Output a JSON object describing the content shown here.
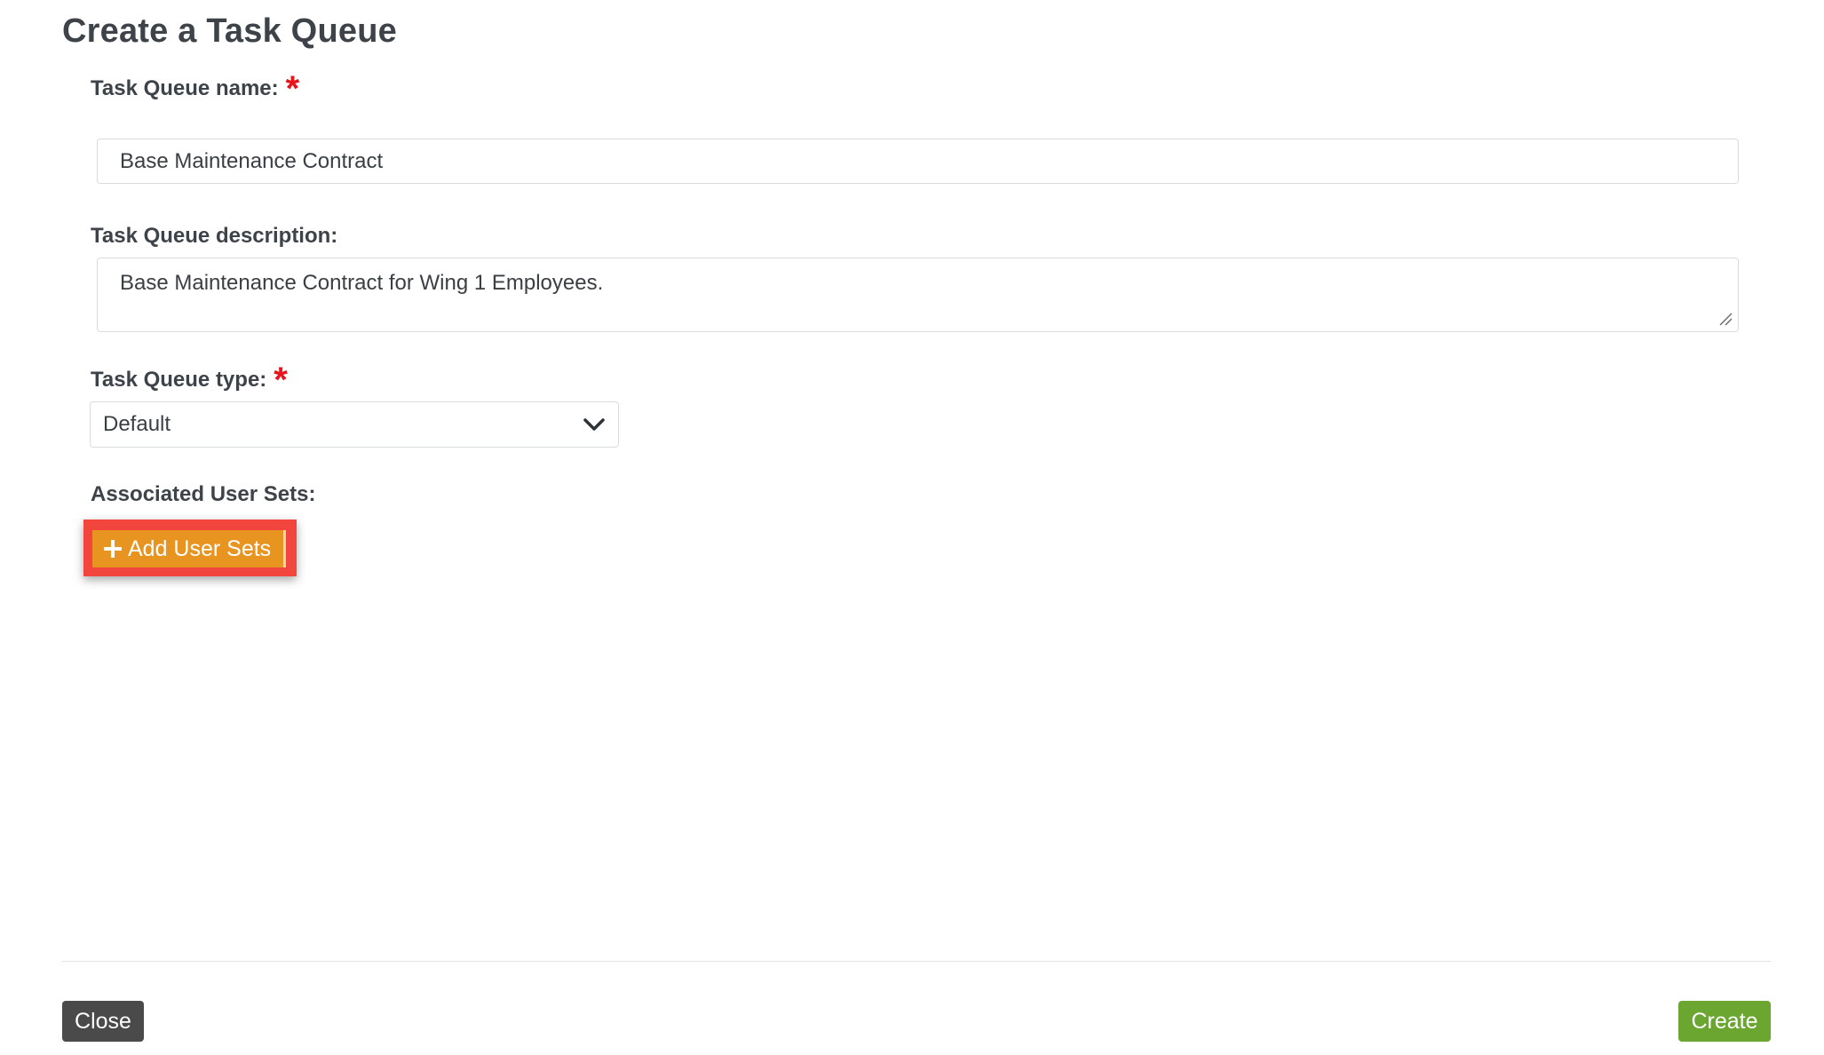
{
  "dialog": {
    "title": "Create a Task Queue"
  },
  "form": {
    "name": {
      "label": "Task Queue name:",
      "required_marker": "*",
      "value": "Base Maintenance Contract"
    },
    "description": {
      "label": "Task Queue description:",
      "value": "Base Maintenance Contract for Wing 1 Employees."
    },
    "type": {
      "label": "Task Queue type:",
      "required_marker": "*",
      "selected": "Default",
      "icon": "chevron-down-icon"
    },
    "user_sets": {
      "label": "Associated User Sets:",
      "add_button_icon": "plus-icon",
      "add_button_label": "Add User Sets"
    }
  },
  "footer": {
    "close_label": "Close",
    "create_label": "Create"
  },
  "colors": {
    "required": "#e8141b",
    "add_button": "#e89421",
    "highlight": "#f2453d",
    "close_button": "#4a4a4a",
    "create_button": "#6aa630"
  }
}
